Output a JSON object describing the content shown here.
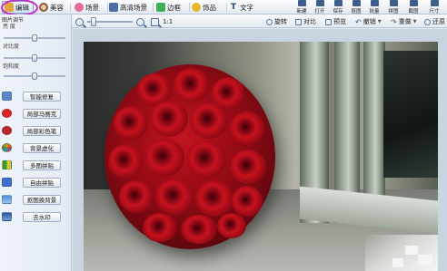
{
  "tabs": [
    {
      "label": "编辑",
      "icon": "edit-icon",
      "active": true
    },
    {
      "label": "美容",
      "icon": "face-icon"
    },
    {
      "label": "场景",
      "icon": "scene-icon"
    },
    {
      "label": "高清场景",
      "icon": "hd-scene-icon"
    },
    {
      "label": "边框",
      "icon": "frame-icon"
    },
    {
      "label": "饰品",
      "icon": "decoration-icon"
    },
    {
      "label": "文字",
      "icon": "text-icon"
    }
  ],
  "top_actions": [
    "新建",
    "打开",
    "保存",
    "抠图",
    "批量",
    "拼图",
    "截图",
    "尺寸"
  ],
  "toolbar": {
    "zoom_ratio": "1:1",
    "rotate": "旋转",
    "compare": "对比",
    "preview": "预览",
    "undo": "撤销",
    "redo": "重做",
    "restore": "还原"
  },
  "adjust": {
    "header": "图片调节",
    "brightness": "亮  度",
    "contrast": "对比度",
    "saturation": "饱和度"
  },
  "tools": [
    {
      "label": "智能修复",
      "icon": "smart-fix-icon",
      "color": "#5b86c9"
    },
    {
      "label": "局部马赛克",
      "icon": "mosaic-icon",
      "color": "#d8252a"
    },
    {
      "label": "局部彩色笔",
      "icon": "color-pen-icon",
      "color": "#b8262f"
    },
    {
      "label": "背景虚化",
      "icon": "blur-bg-icon",
      "color": "#e49a1d"
    },
    {
      "label": "多图拼贴",
      "icon": "collage-icon",
      "color": "#2f9e3a"
    },
    {
      "label": "自由拼贴",
      "icon": "free-collage-icon",
      "color": "#3d6fd1"
    },
    {
      "label": "抠图换背景",
      "icon": "cutout-icon",
      "color": "#4f8fd6"
    },
    {
      "label": "去水印",
      "icon": "remove-watermark-icon",
      "color": "#2c5aa0"
    }
  ]
}
